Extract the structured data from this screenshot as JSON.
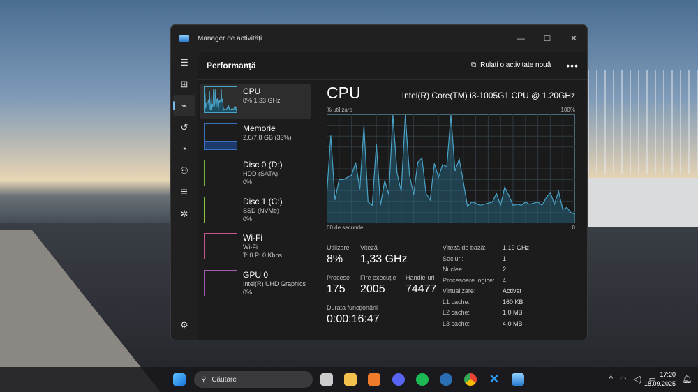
{
  "window": {
    "title": "Manager de activități",
    "minimize": "—",
    "maximize": "☐",
    "close": "✕"
  },
  "header": {
    "title": "Performanță",
    "new_task": "Rulați o activitate nouă",
    "more": "•••"
  },
  "sidebar": [
    {
      "name": "CPU",
      "sub1": "8%  1,33 GHz",
      "sub2": "",
      "color": "#4aa3c7"
    },
    {
      "name": "Memorie",
      "sub1": "2,6/7,8 GB (33%)",
      "sub2": "",
      "color": "#3d6fc0"
    },
    {
      "name": "Disc 0 (D:)",
      "sub1": "HDD (SATA)",
      "sub2": "0%",
      "color": "#7ab33a"
    },
    {
      "name": "Disc 1 (C:)",
      "sub1": "SSD (NVMe)",
      "sub2": "0%",
      "color": "#8cc63f"
    },
    {
      "name": "Wi-Fi",
      "sub1": "Wi-Fi",
      "sub2": "T: 0  P: 0 Kbps",
      "color": "#c4548f"
    },
    {
      "name": "GPU 0",
      "sub1": "Intel(R) UHD Graphics",
      "sub2": "0%",
      "color": "#a05ab0"
    }
  ],
  "cpu": {
    "title": "CPU",
    "model": "Intel(R) Core(TM) i3-1005G1 CPU @ 1.20GHz",
    "stats": {
      "util_label": "Utilizare",
      "util": "8%",
      "speed_label": "Viteză",
      "speed": "1,33 GHz",
      "proc_label": "Procese",
      "proc": "175",
      "threads_label": "Fire execuție",
      "threads": "2005",
      "handles_label": "Handle-uri",
      "handles": "74477",
      "uptime_label": "Durata funcționării",
      "uptime": "0:00:16:47"
    },
    "specs": [
      [
        "Viteză de bază:",
        "1,19 GHz"
      ],
      [
        "Socluri:",
        "1"
      ],
      [
        "Nuclee:",
        "2"
      ],
      [
        "Procesoare logice:",
        "4"
      ],
      [
        "Virtualizare:",
        "Activat"
      ],
      [
        "L1 cache:",
        "160 KB"
      ],
      [
        "L2 cache:",
        "1,0 MB"
      ],
      [
        "L3 cache:",
        "4,0 MB"
      ]
    ]
  },
  "chart_data": {
    "type": "area",
    "title": "% utilizare",
    "ylabel": "% utilizare",
    "ymax_label": "100%",
    "xlabel_left": "60 de secunde",
    "xlabel_right": "0",
    "ylim": [
      0,
      100
    ],
    "xlim": [
      60,
      0
    ],
    "color": "#4aa3c7",
    "values": [
      25,
      81,
      21,
      40,
      40,
      42,
      44,
      56,
      31,
      90,
      19,
      16,
      73,
      16,
      39,
      26,
      100,
      46,
      29,
      100,
      44,
      26,
      56,
      60,
      27,
      21,
      55,
      42,
      54,
      52,
      100,
      48,
      59,
      38,
      15,
      19,
      18,
      16,
      17,
      18,
      19,
      27,
      16,
      33,
      25,
      16,
      17,
      16,
      19,
      17,
      18,
      19,
      16,
      23,
      28,
      17,
      29,
      12,
      14,
      9,
      8
    ]
  },
  "taskbar": {
    "search": "Căutare",
    "time": "17:20",
    "date": "18.09.2025"
  }
}
